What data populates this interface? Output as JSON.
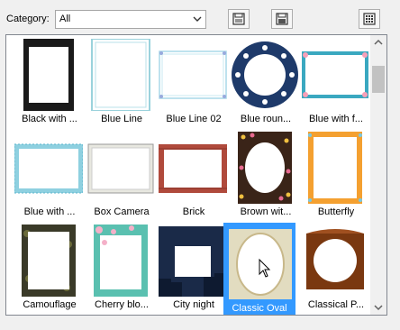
{
  "category": {
    "label": "Category:",
    "value": "All"
  },
  "toolbar": {
    "buttons": [
      "save-layout-icon",
      "open-layout-icon",
      "grid-view-icon"
    ]
  },
  "items": [
    {
      "label": "Black with ...",
      "icon": "black-frame-thumbnail"
    },
    {
      "label": "Blue Line",
      "icon": "blue-line-thumbnail"
    },
    {
      "label": "Blue Line 02",
      "icon": "blue-line-02-thumbnail"
    },
    {
      "label": "Blue roun...",
      "icon": "blue-round-thumbnail"
    },
    {
      "label": "Blue with f...",
      "icon": "blue-with-flowers-thumbnail"
    },
    {
      "label": "Blue with ...",
      "icon": "blue-with-stripes-thumbnail"
    },
    {
      "label": "Box Camera",
      "icon": "box-camera-thumbnail"
    },
    {
      "label": "Brick",
      "icon": "brick-thumbnail"
    },
    {
      "label": "Brown wit...",
      "icon": "brown-with-flowers-thumbnail"
    },
    {
      "label": "Butterfly",
      "icon": "butterfly-thumbnail"
    },
    {
      "label": "Camouflage",
      "icon": "camouflage-thumbnail"
    },
    {
      "label": "Cherry blo...",
      "icon": "cherry-blossom-thumbnail"
    },
    {
      "label": "City night",
      "icon": "city-night-thumbnail"
    },
    {
      "label": "Classic Oval",
      "icon": "classic-oval-thumbnail",
      "selected": true
    },
    {
      "label": "Classical P...",
      "icon": "classical-thumbnail"
    }
  ],
  "colors": {
    "selection": "#3399ff",
    "border": "#828790"
  }
}
